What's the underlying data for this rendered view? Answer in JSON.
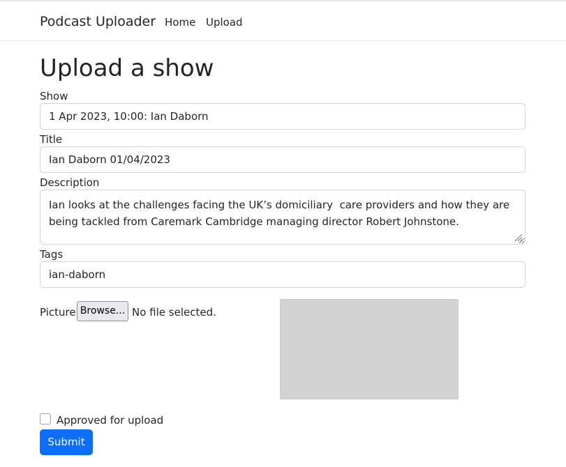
{
  "navbar": {
    "brand": "Podcast Uploader",
    "links": [
      "Home",
      "Upload"
    ]
  },
  "page": {
    "title": "Upload a show"
  },
  "form": {
    "show": {
      "label": "Show",
      "value": "1 Apr 2023, 10:00: Ian Daborn"
    },
    "title": {
      "label": "Title",
      "value": "Ian Daborn 01/04/2023"
    },
    "description": {
      "label": "Description",
      "value": "Ian looks at the challenges facing the UK’s domiciliary  care providers and how they are being tackled from Caremark Cambridge managing director Robert Johnstone."
    },
    "tags": {
      "label": "Tags",
      "value": "ian-daborn"
    },
    "picture": {
      "label": "Picture",
      "browse_label": "Browse...",
      "status": "No file selected."
    },
    "approved": {
      "label": "Approved for upload",
      "checked": false
    },
    "submit_label": "Submit"
  },
  "colors": {
    "primary": "#0d6efd",
    "preview_placeholder": "#d3d3d3",
    "text": "#212529"
  },
  "icons": [
    "resize-grip-icon"
  ]
}
